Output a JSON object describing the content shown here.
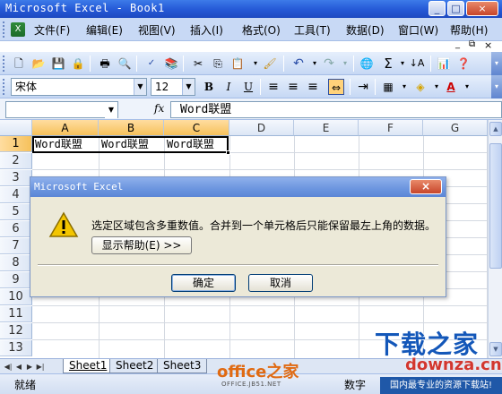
{
  "window": {
    "title": "Microsoft Excel - Book1",
    "controls": [
      "_",
      "□",
      "×"
    ]
  },
  "menu": {
    "items": [
      "文件(F)",
      "编辑(E)",
      "视图(V)",
      "插入(I)",
      "格式(O)",
      "工具(T)",
      "数据(D)",
      "窗口(W)",
      "帮助(H)"
    ],
    "doc_controls": [
      "_",
      "⧉",
      "×"
    ]
  },
  "toolbar_standard": {
    "icons": [
      "new-icon",
      "open-icon",
      "save-icon",
      "permission-icon",
      "print-icon",
      "print-preview-icon",
      "spelling-icon",
      "research-icon",
      "cut-icon",
      "copy-icon",
      "paste-icon",
      "format-painter-icon",
      "undo-icon",
      "redo-icon",
      "hyperlink-icon",
      "autosum-icon",
      "sort-ascending-icon",
      "chart-wizard-icon",
      "help-icon"
    ]
  },
  "toolbar_formatting": {
    "font_name": "宋体",
    "font_size": "12",
    "bold": "B",
    "italic": "I",
    "underline": "U"
  },
  "formula_bar": {
    "name_box": "",
    "fx": "fx",
    "formula": "Word联盟"
  },
  "grid": {
    "columns": [
      "A",
      "B",
      "C",
      "D",
      "E",
      "F",
      "G"
    ],
    "selected_columns": [
      "A",
      "B",
      "C"
    ],
    "rows": [
      "1",
      "2",
      "3",
      "4",
      "5",
      "6",
      "7",
      "8",
      "9",
      "10",
      "11",
      "12",
      "13"
    ],
    "selected_row": "1",
    "cells": {
      "A1": "Word联盟",
      "B1": "Word联盟",
      "C1": "Word联盟"
    }
  },
  "sheets": {
    "tabs": [
      "Sheet1",
      "Sheet2",
      "Sheet3"
    ],
    "active": "Sheet1"
  },
  "status": {
    "ready": "就绪",
    "mode": "数字"
  },
  "dialog": {
    "title": "Microsoft Excel",
    "message": "选定区域包含多重数值。合并到一个单元格后只能保留最左上角的数据。",
    "help_button": "显示帮助(E) >>",
    "ok_button": "确定",
    "cancel_button": "取消",
    "close_glyph": "×"
  },
  "watermarks": {
    "site": "下载之家",
    "domain": "downza.cn",
    "tagline": "国内最专业的资源下载站!",
    "office": "office之家",
    "office_url": "OFFICE.JB51.NET"
  },
  "colors": {
    "title_blue": "#2458d6",
    "header_selected": "#f6c15b",
    "warning_yellow": "#f3c500"
  }
}
